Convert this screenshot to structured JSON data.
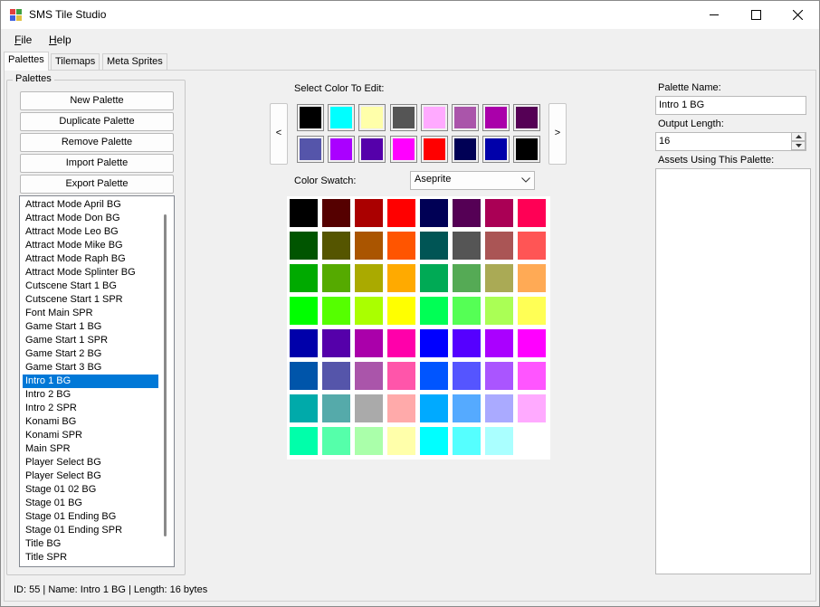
{
  "window": {
    "title": "SMS Tile Studio",
    "controls": [
      "minimize-icon",
      "maximize-icon",
      "close-icon"
    ]
  },
  "menu": [
    {
      "label": "File",
      "accel": "F",
      "rest": "ile"
    },
    {
      "label": "Help",
      "accel": "H",
      "rest": "elp"
    }
  ],
  "tabs": [
    "Palettes",
    "Tilemaps",
    "Meta Sprites"
  ],
  "palettes_group": {
    "title": "Palettes",
    "buttons": [
      "New Palette",
      "Duplicate Palette",
      "Remove Palette",
      "Import Palette",
      "Export Palette"
    ],
    "selected_index": 13,
    "items": [
      "Attract Mode April BG",
      "Attract Mode Don BG",
      "Attract Mode Leo BG",
      "Attract Mode Mike BG",
      "Attract Mode Raph BG",
      "Attract Mode Splinter BG",
      "Cutscene Start 1 BG",
      "Cutscene Start 1 SPR",
      "Font Main SPR",
      "Game Start 1 BG",
      "Game Start 1 SPR",
      "Game Start 2 BG",
      "Game Start 3 BG",
      "Intro 1 BG",
      "Intro 2 BG",
      "Intro 2 SPR",
      "Konami BG",
      "Konami SPR",
      "Main SPR",
      "Player Select BG",
      "Player Select BG",
      "Stage 01 02 BG",
      "Stage 01 BG",
      "Stage 01 Ending BG",
      "Stage 01 Ending SPR",
      "Title BG",
      "Title SPR"
    ]
  },
  "editor": {
    "select_label": "Select Color To Edit:",
    "prev_label": "<",
    "next_label": ">",
    "edit_colors": [
      "#000000",
      "#00ffff",
      "#ffffaa",
      "#555555",
      "#ffaaff",
      "#aa55aa",
      "#aa00aa",
      "#550055",
      "#5555aa",
      "#aa00ff",
      "#5500aa",
      "#ff00ff",
      "#ff0000",
      "#000055",
      "#0000aa",
      "#000000"
    ],
    "swatch_label": "Color Swatch:",
    "swatch_value": "Aseprite",
    "swatch_colors": [
      "#000000",
      "#550000",
      "#aa0000",
      "#ff0000",
      "#000055",
      "#550055",
      "#aa0055",
      "#ff0055",
      "#005500",
      "#555500",
      "#aa5500",
      "#ff5500",
      "#005555",
      "#555555",
      "#aa5555",
      "#ff5555",
      "#00aa00",
      "#55aa00",
      "#aaaa00",
      "#ffaa00",
      "#00aa55",
      "#55aa55",
      "#aaaa55",
      "#ffaa55",
      "#00ff00",
      "#55ff00",
      "#aaff00",
      "#ffff00",
      "#00ff55",
      "#55ff55",
      "#aaff55",
      "#ffff55",
      "#0000aa",
      "#5500aa",
      "#aa00aa",
      "#ff00aa",
      "#0000ff",
      "#5500ff",
      "#aa00ff",
      "#ff00ff",
      "#0055aa",
      "#5555aa",
      "#aa55aa",
      "#ff55aa",
      "#0055ff",
      "#5555ff",
      "#aa55ff",
      "#ff55ff",
      "#00aaaa",
      "#55aaaa",
      "#aaaaaa",
      "#ffaaaa",
      "#00aaff",
      "#55aaff",
      "#aaaaff",
      "#ffaaff",
      "#00ffaa",
      "#55ffaa",
      "#aaffaa",
      "#ffffaa",
      "#00ffff",
      "#55ffff",
      "#aaffff",
      "#ffffff"
    ]
  },
  "properties": {
    "name_label": "Palette Name:",
    "name_value": "Intro 1 BG",
    "length_label": "Output Length:",
    "length_value": "16",
    "assets_label": "Assets Using This Palette:",
    "assets": []
  },
  "status": {
    "text": "ID: 55 | Name: Intro 1 BG | Length: 16 bytes"
  }
}
